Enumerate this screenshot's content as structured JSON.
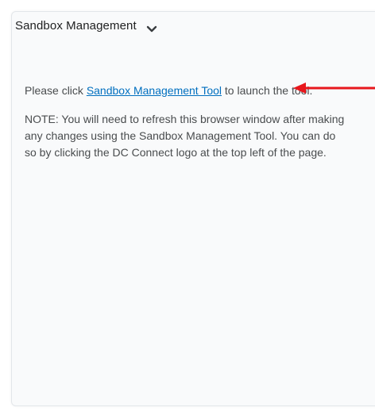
{
  "widget": {
    "title": "Sandbox Management"
  },
  "body": {
    "intro_prefix": "Please click ",
    "link_text": "Sandbox Management Tool",
    "intro_suffix": " to launch the tool.",
    "note": "NOTE: You will need to refresh this browser window after making any changes using the Sandbox Management Tool. You can do so by clicking the DC Connect logo at the top left of the page."
  },
  "colors": {
    "link": "#006fbf",
    "arrow": "#e8171c",
    "text": "#494c4e",
    "title": "#202122"
  },
  "icons": {
    "collapse": "chevron-down-icon",
    "annotation": "red-arrow-icon"
  }
}
